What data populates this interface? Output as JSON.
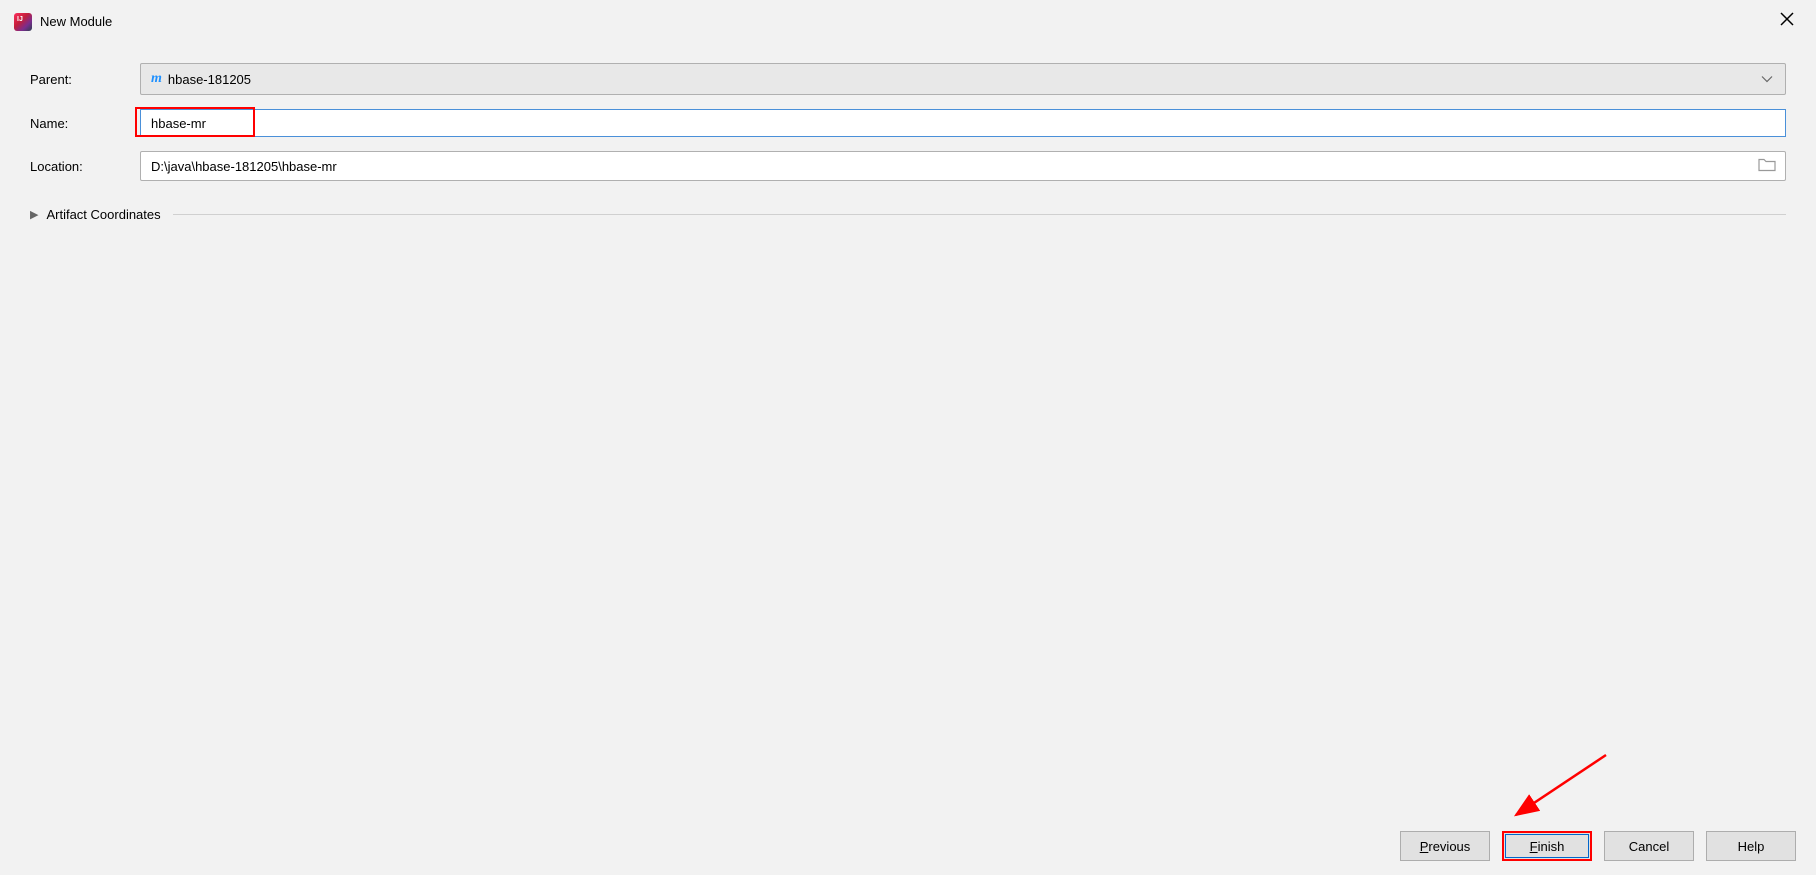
{
  "window": {
    "title": "New Module"
  },
  "form": {
    "parent": {
      "label": "Parent:",
      "value": "hbase-181205",
      "iconText": "m"
    },
    "name": {
      "label": "Name:",
      "value": "hbase-mr"
    },
    "location": {
      "label": "Location:",
      "value": "D:\\java\\hbase-181205\\hbase-mr"
    },
    "artifact": {
      "label": "Artifact Coordinates"
    }
  },
  "buttons": {
    "previous": "Previous",
    "finish": "Finish",
    "cancel": "Cancel",
    "help": "Help"
  }
}
